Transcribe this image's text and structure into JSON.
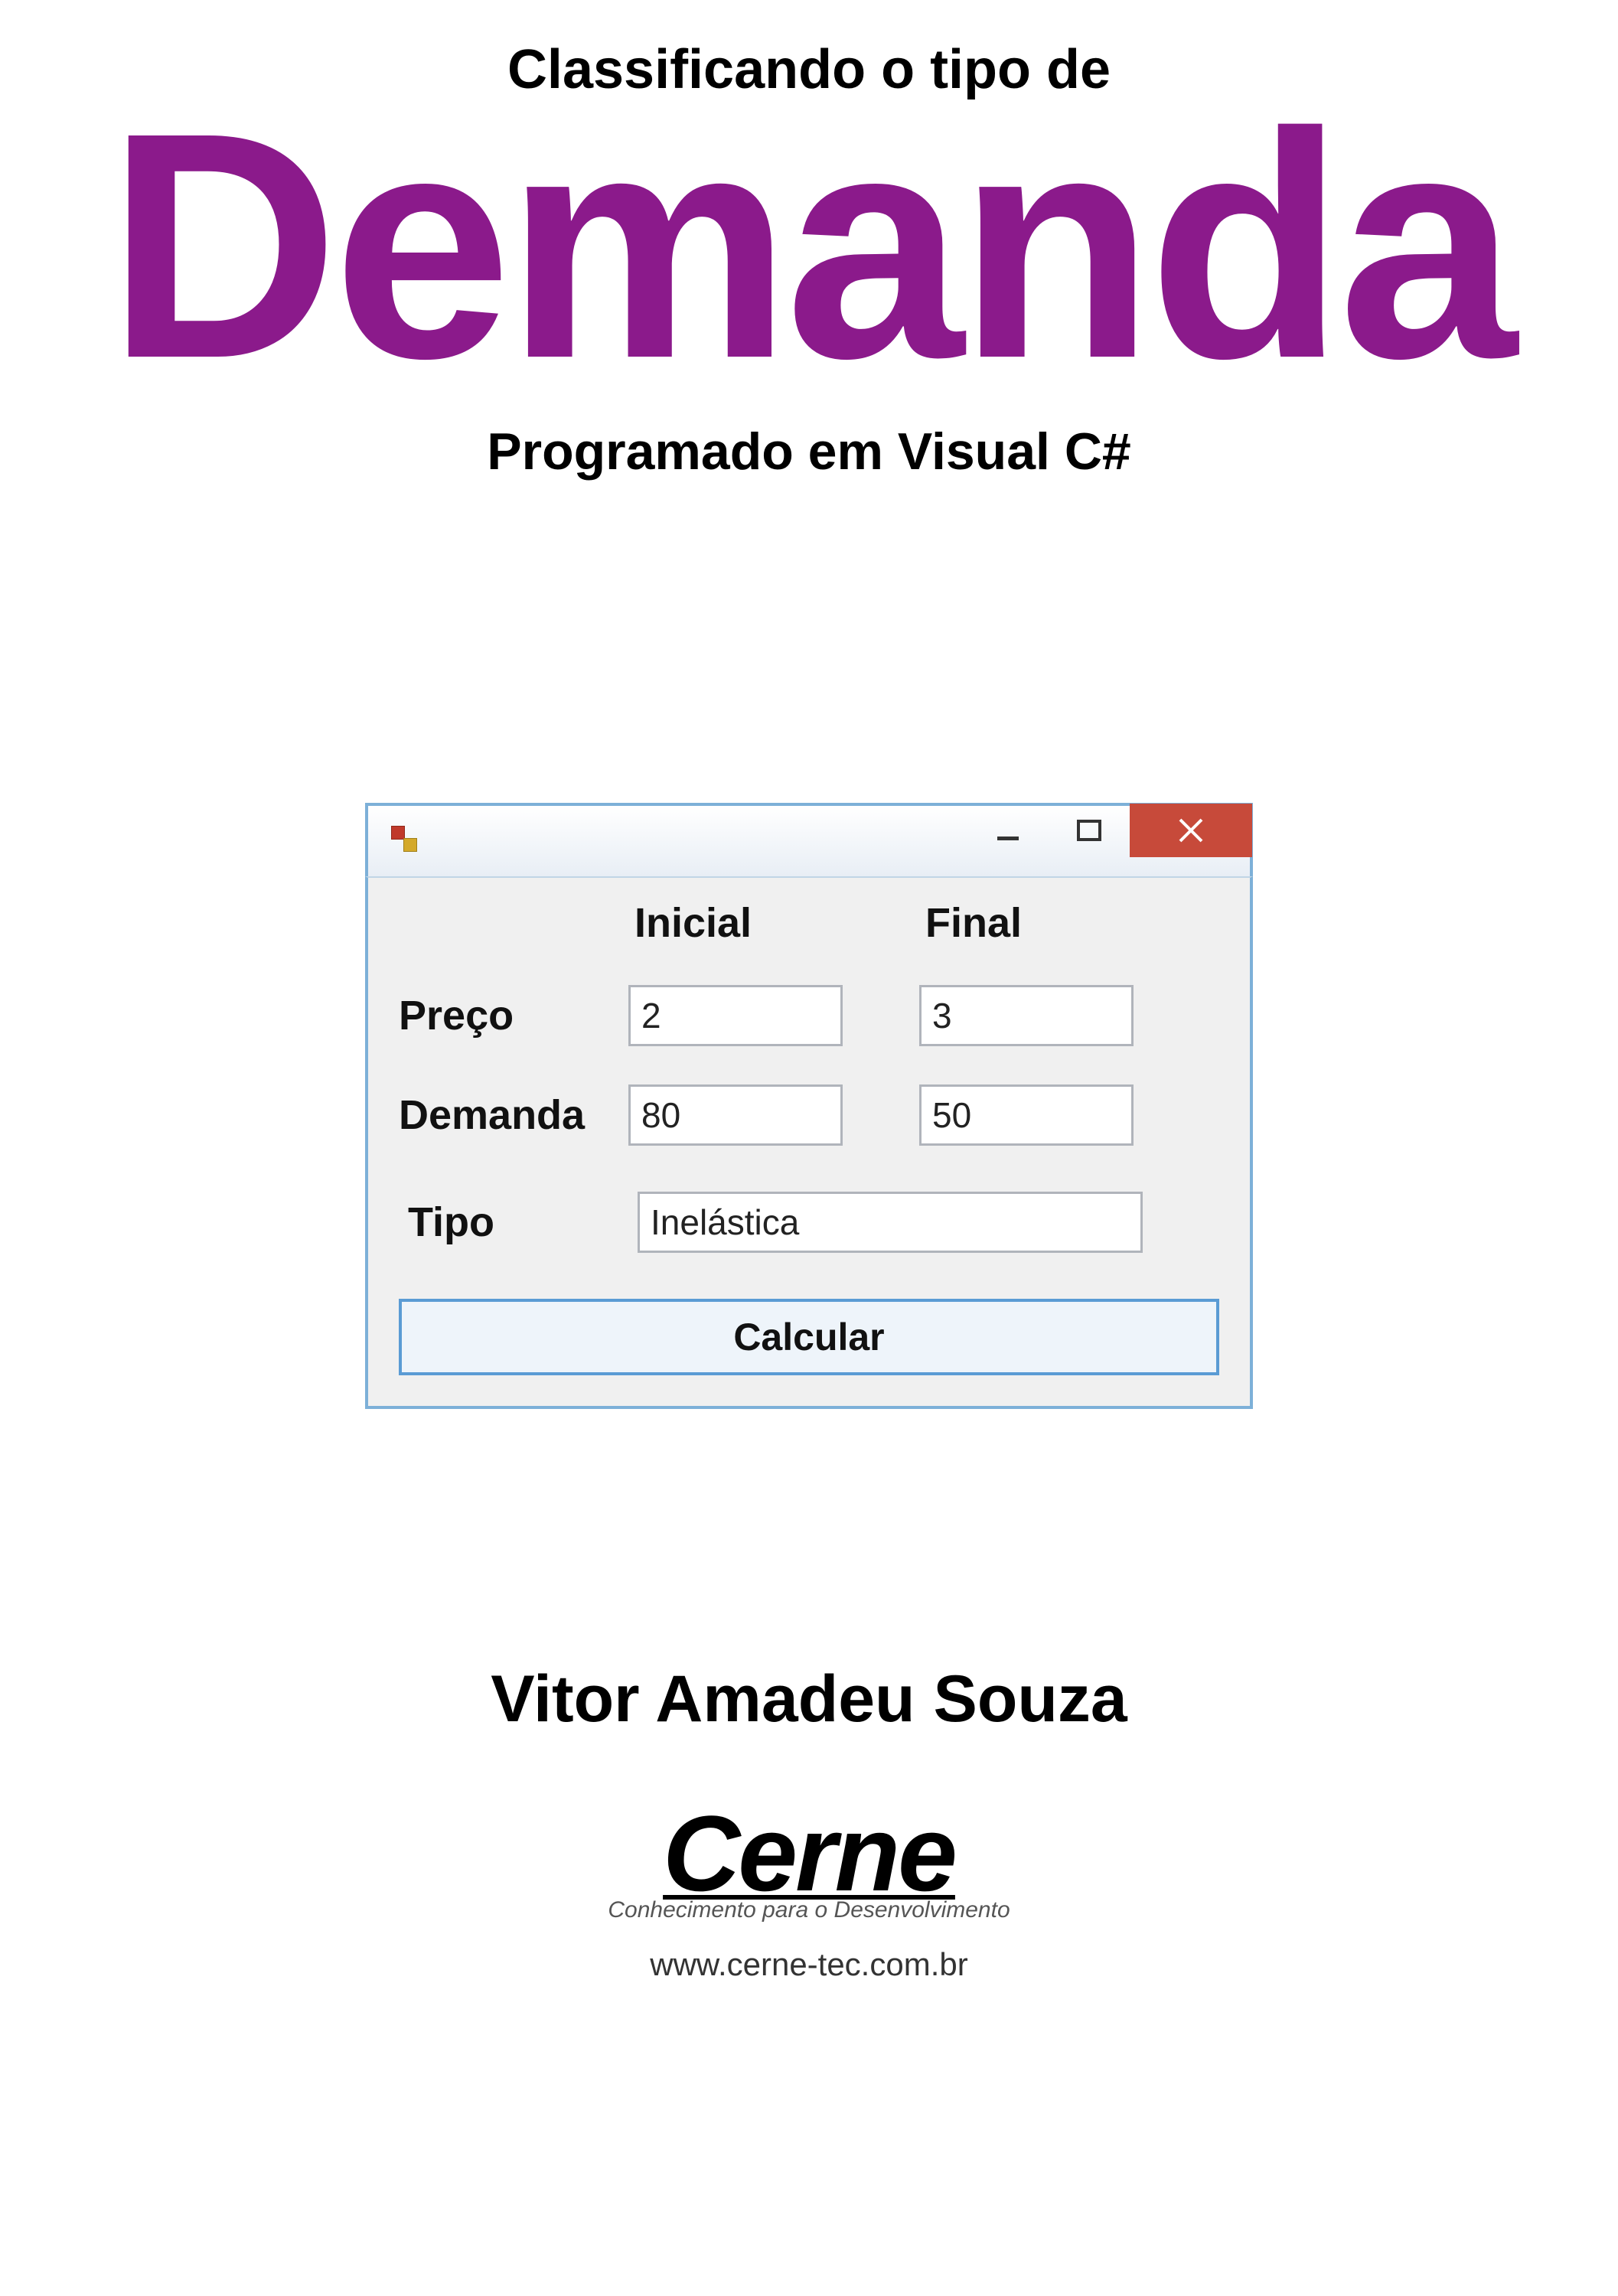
{
  "header": {
    "subtitle_top": "Classificando o tipo de",
    "title": "Demanda",
    "subtitle_bottom": "Programado em Visual C#"
  },
  "window": {
    "columns": {
      "initial": "Inicial",
      "final": "Final"
    },
    "rows": {
      "price_label": "Preço",
      "demand_label": "Demanda",
      "type_label": "Tipo"
    },
    "values": {
      "price_initial": "2",
      "price_final": "3",
      "demand_initial": "80",
      "demand_final": "50",
      "type_result": "Inelástica"
    },
    "calc_button": "Calcular"
  },
  "author": "Vitor Amadeu Souza",
  "brand": {
    "name": "Cerne",
    "tagline": "Conhecimento para o Desenvolvimento",
    "url": "www.cerne-tec.com.br"
  }
}
